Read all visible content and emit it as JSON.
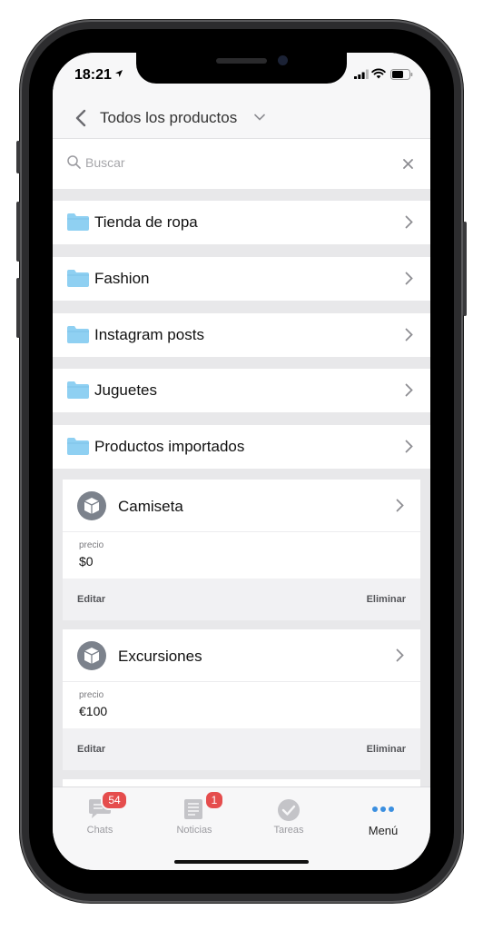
{
  "status_bar": {
    "time": "18:21"
  },
  "header": {
    "title": "Todos los productos"
  },
  "search": {
    "placeholder": "Buscar"
  },
  "folders": [
    {
      "label": "Tienda de ropa"
    },
    {
      "label": "Fashion"
    },
    {
      "label": "Instagram posts"
    },
    {
      "label": "Juguetes"
    },
    {
      "label": "Productos importados"
    }
  ],
  "products": [
    {
      "title": "Camiseta",
      "price_label": "precio",
      "price": "$0",
      "edit_label": "Editar",
      "delete_label": "Eliminar"
    },
    {
      "title": "Excursiones",
      "price_label": "precio",
      "price": "€100",
      "edit_label": "Editar",
      "delete_label": "Eliminar"
    }
  ],
  "tabbar": {
    "items": [
      {
        "label": "Chats",
        "badge": "54",
        "icon": "chat-icon"
      },
      {
        "label": "Noticias",
        "badge": "1",
        "icon": "news-icon"
      },
      {
        "label": "Tareas",
        "icon": "tasks-check-icon"
      },
      {
        "label": "Menú",
        "icon": "more-dots-icon"
      }
    ],
    "active": "Menú"
  },
  "colors": {
    "accent": "#3b8fe0",
    "folder": "#8fd0f2",
    "badge": "#e54d4d",
    "product_icon": "#7c828c"
  }
}
